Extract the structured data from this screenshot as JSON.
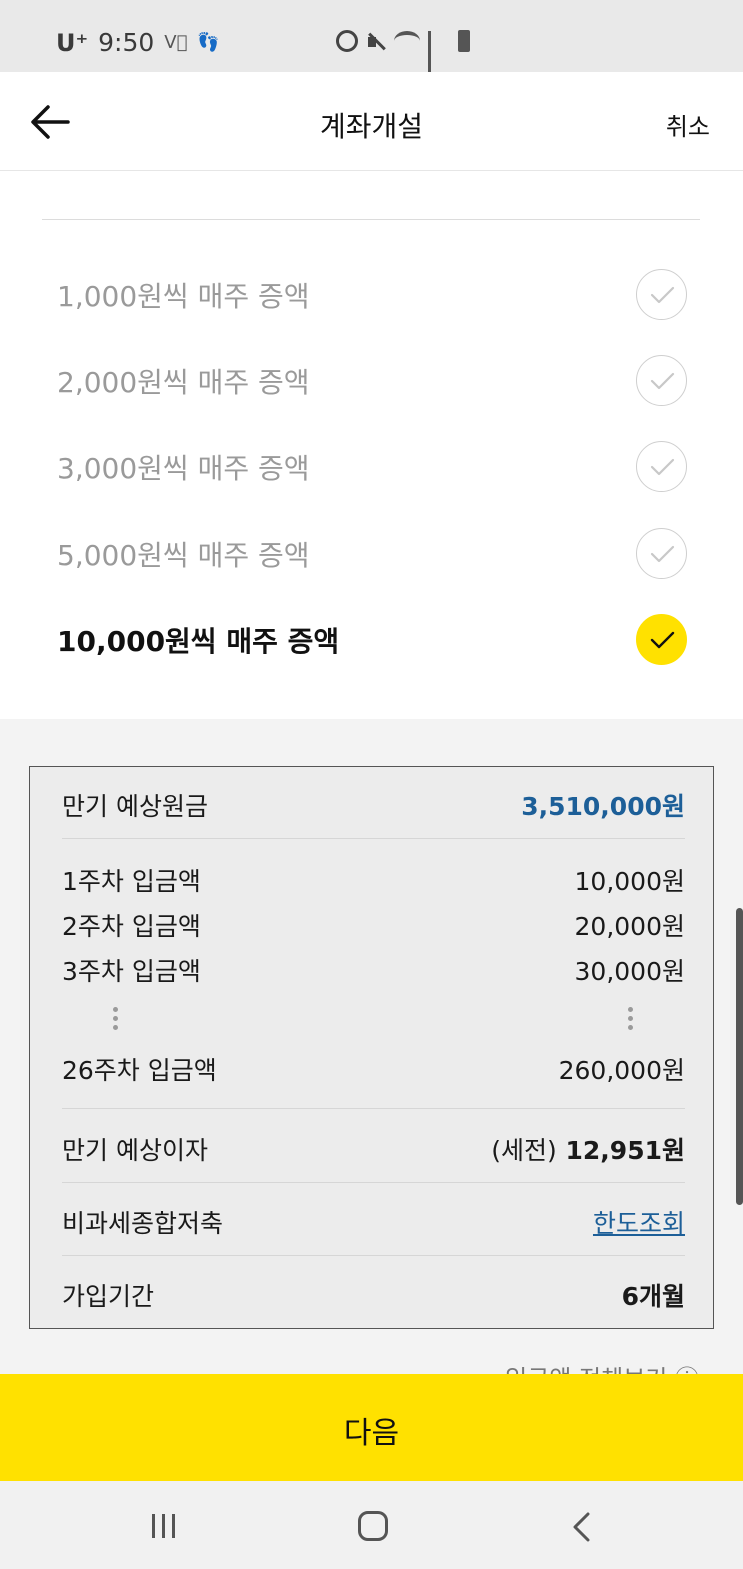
{
  "status_bar": {
    "carrier": "U⁺",
    "time": "9:50",
    "icons": [
      "volte-icon",
      "walking-icon",
      "alarm-icon",
      "mute-icon",
      "wifi-icon",
      "signal-icon",
      "battery-icon"
    ]
  },
  "header": {
    "title": "계좌개설",
    "cancel_label": "취소",
    "back_icon": "arrow-left-icon"
  },
  "options": [
    {
      "label": "1,000원씩 매주 증액",
      "selected": false
    },
    {
      "label": "2,000원씩 매주 증액",
      "selected": false
    },
    {
      "label": "3,000원씩 매주 증액",
      "selected": false
    },
    {
      "label": "5,000원씩 매주 증액",
      "selected": false
    },
    {
      "label": "10,000원씩 매주 증액",
      "selected": true
    }
  ],
  "summary": {
    "maturity_principal_label": "만기 예상원금",
    "maturity_principal_value": "3,510,000원",
    "weeks": [
      {
        "label": "1주차 입금액",
        "value": "10,000원"
      },
      {
        "label": "2주차 입금액",
        "value": "20,000원"
      },
      {
        "label": "3주차 입금액",
        "value": "30,000원"
      },
      {
        "label": "26주차 입금액",
        "value": "260,000원"
      }
    ],
    "interest_label": "만기 예상이자",
    "interest_prefix": "(세전)",
    "interest_value": "12,951원",
    "taxfree_label": "비과세종합저축",
    "taxfree_link": "한도조회",
    "period_label": "가입기간",
    "period_value": "6개월"
  },
  "peek_text": "입금액 전체보기 ⓘ",
  "next_button_label": "다음",
  "colors": {
    "accent_yellow": "#ffe100",
    "link_blue": "#1d5f98",
    "muted_text": "#9a9a9a"
  }
}
